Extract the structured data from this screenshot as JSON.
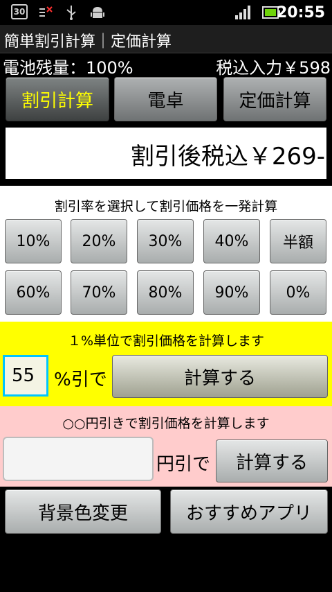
{
  "status": {
    "calendar_day": "30",
    "time": "20:55"
  },
  "title": "簡単割引計算｜定価計算",
  "info": {
    "battery": "電池残量：100%",
    "tax_input": "税込入力￥598"
  },
  "tabs": {
    "discount": "割引計算",
    "calculator": "電卓",
    "list_price": "定価計算"
  },
  "result": "割引後税込￥269-",
  "preset_section": {
    "caption": "割引率を選択して割引価格を一発計算",
    "row1": [
      "10%",
      "20%",
      "30%",
      "40%",
      "半額"
    ],
    "row2": [
      "60%",
      "70%",
      "80%",
      "90%",
      "0%"
    ]
  },
  "percent_section": {
    "caption": "１%単位で割引価格を計算します",
    "value": "55",
    "suffix": "%引で",
    "button": "計算する"
  },
  "yen_section": {
    "caption": "○○円引きで割引価格を計算します",
    "value": "",
    "suffix": "円引で",
    "button": "計算する"
  },
  "bottom": {
    "bg_color": "背景色変更",
    "recommended": "おすすめアプリ"
  },
  "colors": {
    "accent_yellow": "#ffff00",
    "pink": "#ffcccc",
    "input_border": "#00c5ff"
  }
}
